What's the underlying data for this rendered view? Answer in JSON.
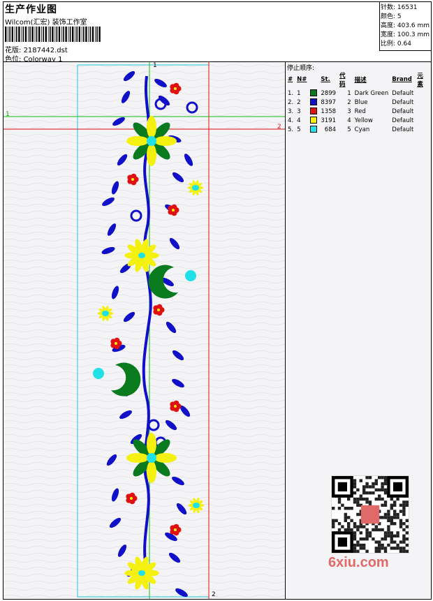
{
  "header": {
    "title": "生产作业图",
    "studio": "Wilcom(汇宏) 装饰工作室",
    "design_label": "花版:",
    "design_value": "2187442.dst",
    "colorway_label": "色位:",
    "colorway_value": "Colorway 1"
  },
  "stats": {
    "stitches": "针数: 16531",
    "colors": "颜色: 5",
    "height": "高度: 403.6 mm",
    "width": "宽度: 100.3 mm",
    "scale": "比例: 0.64"
  },
  "panel": {
    "stop_sequence_label": "停止顺序:",
    "columns": [
      "#",
      "N#",
      "St.",
      "代码",
      "描述",
      "Brand",
      "元素"
    ],
    "rows": [
      {
        "idx": "1.",
        "n": "1",
        "color": "#0a7a1e",
        "st": "2899",
        "code": "1",
        "desc": "Dark Green",
        "brand": "Default"
      },
      {
        "idx": "2.",
        "n": "2",
        "color": "#1010c8",
        "st": "8397",
        "code": "2",
        "desc": "Blue",
        "brand": "Default"
      },
      {
        "idx": "3.",
        "n": "3",
        "color": "#e01010",
        "st": "1358",
        "code": "3",
        "desc": "Red",
        "brand": "Default"
      },
      {
        "idx": "4.",
        "n": "4",
        "color": "#f4f010",
        "st": "3191",
        "code": "4",
        "desc": "Yellow",
        "brand": "Default"
      },
      {
        "idx": "5.",
        "n": "5",
        "color": "#20e0e8",
        "st": "684",
        "code": "5",
        "desc": "Cyan",
        "brand": "Default"
      }
    ]
  },
  "guides": {
    "top_label": "1",
    "left_label": "1",
    "right_label": "2",
    "bottom_label": "2"
  },
  "watermark": {
    "site": "6xiu.com"
  },
  "palette": {
    "dark_green": "#0a7a1e",
    "blue": "#1010c8",
    "red": "#e01010",
    "yellow": "#f4f010",
    "cyan": "#20e0e8"
  }
}
